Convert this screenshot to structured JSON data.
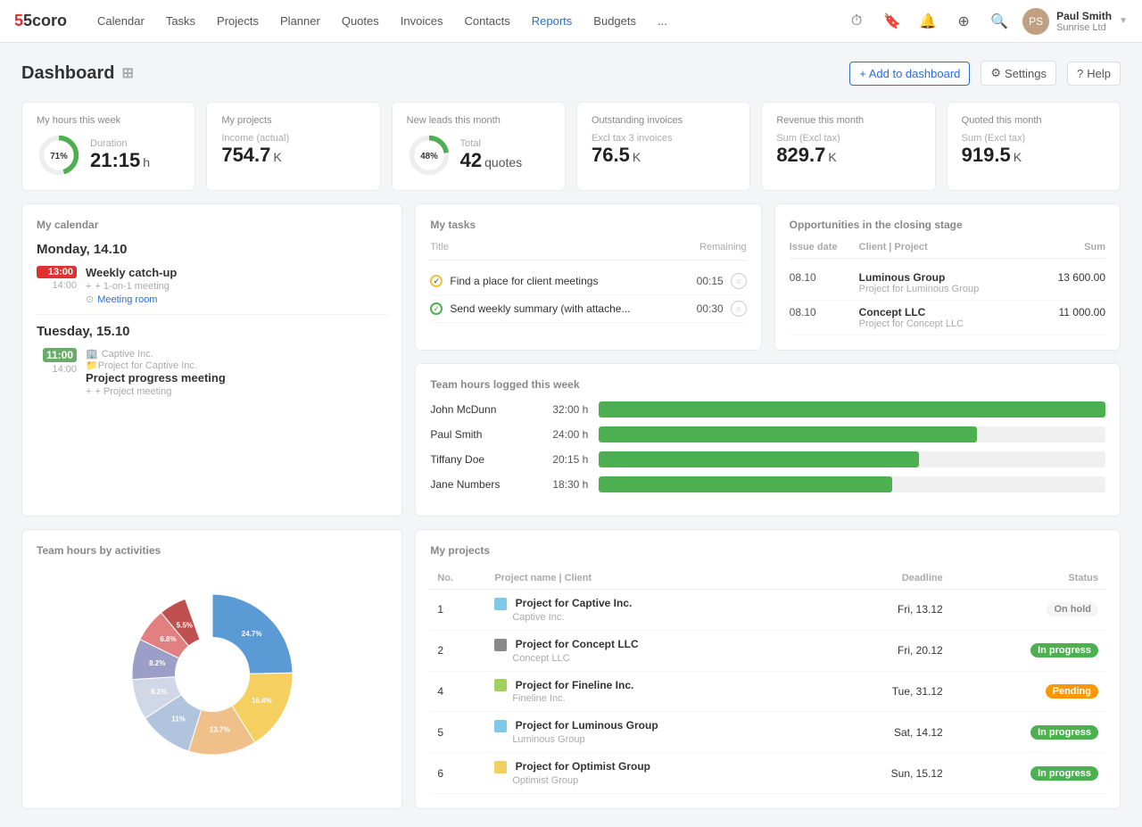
{
  "nav": {
    "logo": "5coro",
    "items": [
      "Calendar",
      "Tasks",
      "Projects",
      "Planner",
      "Quotes",
      "Invoices",
      "Contacts",
      "Reports",
      "Budgets",
      "..."
    ],
    "user": {
      "name": "Paul Smith",
      "company": "Sunrise Ltd"
    }
  },
  "dashboard": {
    "title": "Dashboard",
    "add_btn": "+ Add to dashboard",
    "settings_btn": "Settings",
    "help_btn": "Help"
  },
  "stats": [
    {
      "label": "My hours this week",
      "sub": "Duration",
      "value": "21:15",
      "unit": "h",
      "percent": 71
    },
    {
      "label": "My projects",
      "sub": "Income (actual)",
      "value": "754.7",
      "unit": "K"
    },
    {
      "label": "New leads this month",
      "sub": "Total",
      "value": "42",
      "unit": "quotes",
      "percent": 48
    },
    {
      "label": "Outstanding invoices",
      "sub": "Excl tax  3 invoices",
      "value": "76.5",
      "unit": "K"
    },
    {
      "label": "Revenue this month",
      "sub": "Sum (Excl tax)",
      "value": "829.7",
      "unit": "K"
    },
    {
      "label": "Quoted this month",
      "sub": "Sum (Excl tax)",
      "value": "919.5",
      "unit": "K"
    }
  ],
  "calendar": {
    "title": "My calendar",
    "days": [
      {
        "label": "Monday, 14.10",
        "events": [
          {
            "start": "13:00",
            "end": "14:00",
            "highlight": true,
            "title": "Weekly catch-up",
            "sub1": "+ 1-on-1 meeting",
            "sub2": "Meeting room"
          }
        ]
      },
      {
        "label": "Tuesday, 15.10",
        "events": [
          {
            "start": "11:00",
            "end": "14:00",
            "highlight": false,
            "company": "Captive Inc.",
            "project": "Project for Captive Inc.",
            "title": "Project progress meeting",
            "sub1": "+ Project meeting"
          }
        ]
      }
    ]
  },
  "tasks": {
    "title": "My tasks",
    "col_title": "Title",
    "col_remaining": "Remaining",
    "rows": [
      {
        "done": false,
        "title": "Find a place for client meetings",
        "time": "00:15"
      },
      {
        "done": true,
        "title": "Send weekly summary (with attache...",
        "time": "00:30"
      }
    ]
  },
  "team_hours": {
    "title": "Team hours logged this week",
    "rows": [
      {
        "name": "John McDunn",
        "hours": "32:00 h",
        "pct": 95
      },
      {
        "name": "Paul Smith",
        "hours": "24:00 h",
        "pct": 71
      },
      {
        "name": "Tiffany Doe",
        "hours": "20:15 h",
        "pct": 60
      },
      {
        "name": "Jane Numbers",
        "hours": "18:30 h",
        "pct": 55
      }
    ]
  },
  "opportunities": {
    "title": "Opportunities in the closing stage",
    "col_date": "Issue date",
    "col_client": "Client | Project",
    "col_sum": "Sum",
    "rows": [
      {
        "date": "08.10",
        "client": "Luminous Group",
        "project": "Project for Luminous Group",
        "sum": "13 600.00"
      },
      {
        "date": "08.10",
        "client": "Concept LLC",
        "project": "Project for Concept LLC",
        "sum": "11 000.00"
      }
    ]
  },
  "team_activities": {
    "title": "Team hours by activities",
    "segments": [
      {
        "label": "24.7%",
        "color": "#5b9bd5",
        "pct": 24.7
      },
      {
        "label": "16.4%",
        "color": "#f5d060",
        "pct": 16.4
      },
      {
        "label": "13.7%",
        "color": "#f0c08a",
        "pct": 13.7
      },
      {
        "label": "11%",
        "color": "#b0c4de",
        "pct": 11
      },
      {
        "label": "8.2%",
        "color": "#d0d8e8",
        "pct": 8.2
      },
      {
        "label": "8.2%",
        "color": "#9b9fc8",
        "pct": 8.2
      },
      {
        "label": "6.8%",
        "color": "#e08080",
        "pct": 6.8
      },
      {
        "label": "5.5%",
        "color": "#c05050",
        "pct": 5.5
      }
    ]
  },
  "projects": {
    "title": "My projects",
    "col_no": "No.",
    "col_name": "Project name | Client",
    "col_deadline": "Deadline",
    "col_status": "Status",
    "rows": [
      {
        "no": 1,
        "color": "#7ec8e8",
        "name": "Project for Captive Inc.",
        "client": "Captive Inc.",
        "deadline": "Fri, 13.12",
        "status": "On hold",
        "status_class": "status-on-hold"
      },
      {
        "no": 2,
        "color": "#888",
        "name": "Project for Concept LLC",
        "client": "Concept LLC",
        "deadline": "Fri, 20.12",
        "status": "In progress",
        "status_class": "status-in-progress"
      },
      {
        "no": 4,
        "color": "#a0d060",
        "name": "Project for Fineline Inc.",
        "client": "Fineline Inc.",
        "deadline": "Tue, 31.12",
        "status": "Pending",
        "status_class": "status-pending"
      },
      {
        "no": 5,
        "color": "#7ec8e8",
        "name": "Project for Luminous Group",
        "client": "Luminous Group",
        "deadline": "Sat, 14.12",
        "status": "In progress",
        "status_class": "status-in-progress"
      },
      {
        "no": 6,
        "color": "#f0d060",
        "name": "Project for Optimist Group",
        "client": "Optimist Group",
        "deadline": "Sun, 15.12",
        "status": "In progress",
        "status_class": "status-in-progress"
      }
    ]
  }
}
